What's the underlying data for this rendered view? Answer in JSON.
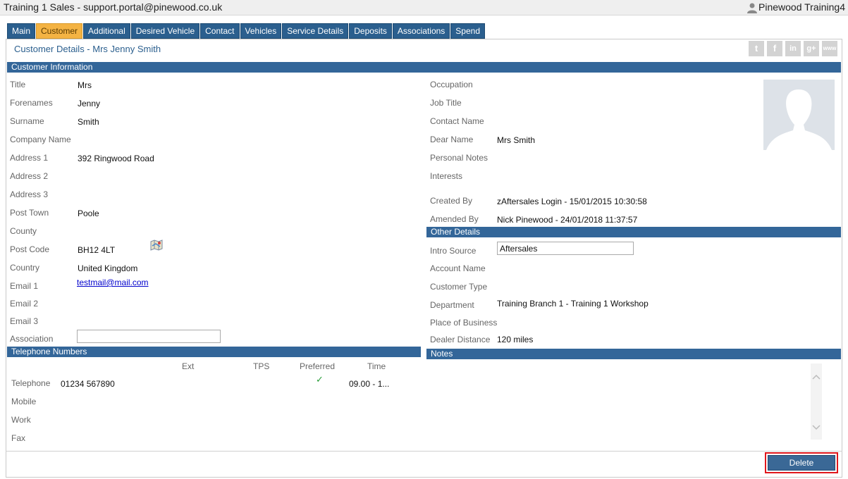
{
  "window": {
    "title": "Training 1 Sales - support.portal@pinewood.co.uk",
    "user": "Pinewood Training4"
  },
  "tabs": [
    "Main",
    "Customer",
    "Additional",
    "Desired Vehicle",
    "Contact",
    "Vehicles",
    "Service Details",
    "Deposits",
    "Associations",
    "Spend"
  ],
  "active_tab": "Customer",
  "page_title": "Customer Details  - Mrs Jenny Smith",
  "social_icons": [
    "twitter-icon",
    "facebook-icon",
    "linkedin-icon",
    "google-plus-icon",
    "website-icon"
  ],
  "social_glyphs": {
    "twitter": "t",
    "facebook": "f",
    "linkedin": "in",
    "google_plus": "g+",
    "web": "www"
  },
  "customer_info": {
    "header": "Customer Information",
    "title_label": "Title",
    "title_value": "Mrs",
    "forenames_label": "Forenames",
    "forenames_value": "Jenny",
    "surname_label": "Surname",
    "surname_value": "Smith",
    "company_label": "Company Name",
    "address1_label": "Address 1",
    "address1_value": "392 Ringwood Road",
    "address2_label": "Address 2",
    "address3_label": "Address 3",
    "posttown_label": "Post Town",
    "posttown_value": "Poole",
    "county_label": "County",
    "postcode_label": "Post Code",
    "postcode_value": "BH12 4LT",
    "country_label": "Country",
    "country_value": "United Kingdom",
    "email1_label": "Email 1",
    "email1_value": "testmail@mail.com",
    "email2_label": "Email 2",
    "email3_label": "Email 3",
    "association_label": "Association",
    "association_value": ""
  },
  "right_info": {
    "occupation_label": "Occupation",
    "jobtitle_label": "Job Title",
    "contactname_label": "Contact Name",
    "dearname_label": "Dear Name",
    "dearname_value": "Mrs Smith",
    "personalnotes_label": "Personal Notes",
    "interests_label": "Interests",
    "createdby_label": "Created By",
    "createdby_value": "zAftersales Login - 15/01/2015 10:30:58",
    "amendedby_label": "Amended By",
    "amendedby_value": "Nick Pinewood - 24/01/2018 11:37:57"
  },
  "other_details": {
    "header": "Other Details",
    "introsource_label": "Intro Source",
    "introsource_value": "Aftersales",
    "accountname_label": "Account Name",
    "customertype_label": "Customer Type",
    "department_label": "Department",
    "department_value": "Training Branch 1 - Training 1 Workshop",
    "placeofbusiness_label": "Place of Business",
    "dealerdistance_label": "Dealer Distance",
    "dealerdistance_value": "120 miles"
  },
  "telephone": {
    "header": "Telephone Numbers",
    "col_ext": "Ext",
    "col_tps": "TPS",
    "col_preferred": "Preferred",
    "col_time": "Time",
    "telephone_label": "Telephone",
    "telephone_value": "01234 567890",
    "telephone_preferred": "✓",
    "telephone_time": "09.00 - 1...",
    "mobile_label": "Mobile",
    "work_label": "Work",
    "fax_label": "Fax"
  },
  "notes": {
    "header": "Notes"
  },
  "footer": {
    "delete_label": "Delete"
  },
  "colors": {
    "section_bar": "#336699",
    "tab": "#2b5f8e",
    "active_tab": "#f4b343",
    "delete_highlight": "#e0161b"
  }
}
